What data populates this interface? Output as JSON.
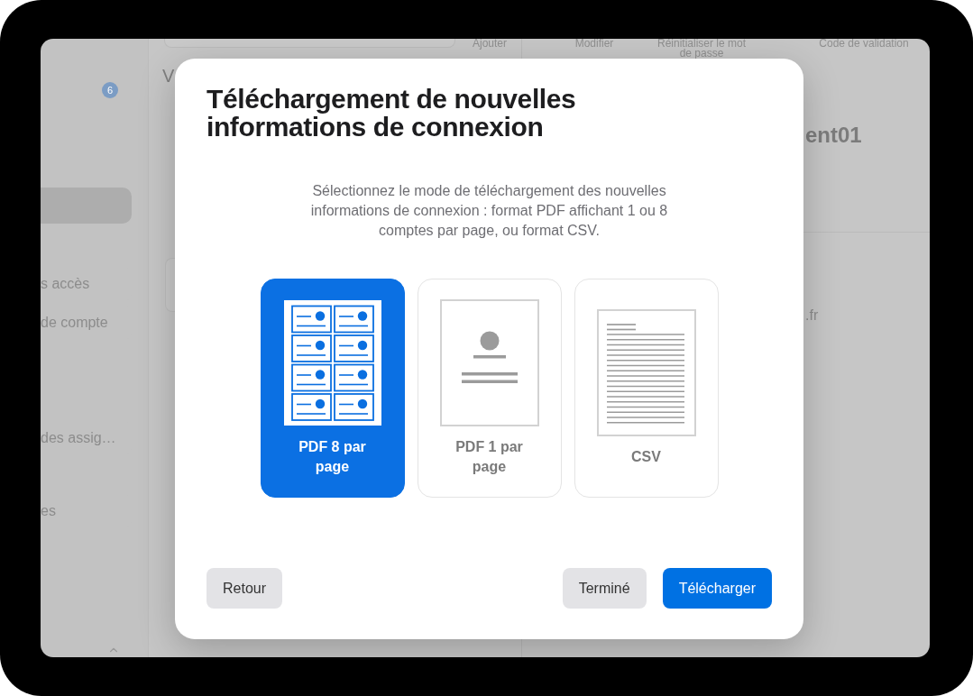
{
  "background": {
    "sidebar": {
      "badge": "6",
      "items": [
        {
          "selected": true
        },
        {
          "label": "s accès",
          "selected": false
        },
        {
          "label": "de compte",
          "selected": false
        },
        {
          "label": "des assig…",
          "selected": false
        },
        {
          "label": "es",
          "selected": false
        }
      ]
    },
    "list": {
      "add_label": "Ajouter",
      "heading": "V"
    },
    "toolbar": [
      "Modifier",
      "Réinitialiser le mot de passe",
      "Code de validation"
    ],
    "detail": {
      "name": "ent01",
      "email": ".fr"
    }
  },
  "dialog": {
    "title": "Téléchargement de nouvelles informations de connexion",
    "description": "Sélectionnez le mode de téléchargement des nouvelles informations de connexion : format PDF affichant 1 ou 8 comptes par page, ou format CSV.",
    "options": [
      {
        "kind": "pdf8",
        "label": "PDF 8 par page",
        "selected": true
      },
      {
        "kind": "pdf1",
        "label": "PDF 1 par page",
        "selected": false
      },
      {
        "kind": "csv",
        "label": "CSV",
        "selected": false
      }
    ],
    "buttons": [
      {
        "label": "Retour",
        "kind": "secondary"
      },
      {
        "label": "Terminé",
        "kind": "secondary"
      },
      {
        "label": "Télécharger",
        "kind": "primary"
      }
    ]
  }
}
